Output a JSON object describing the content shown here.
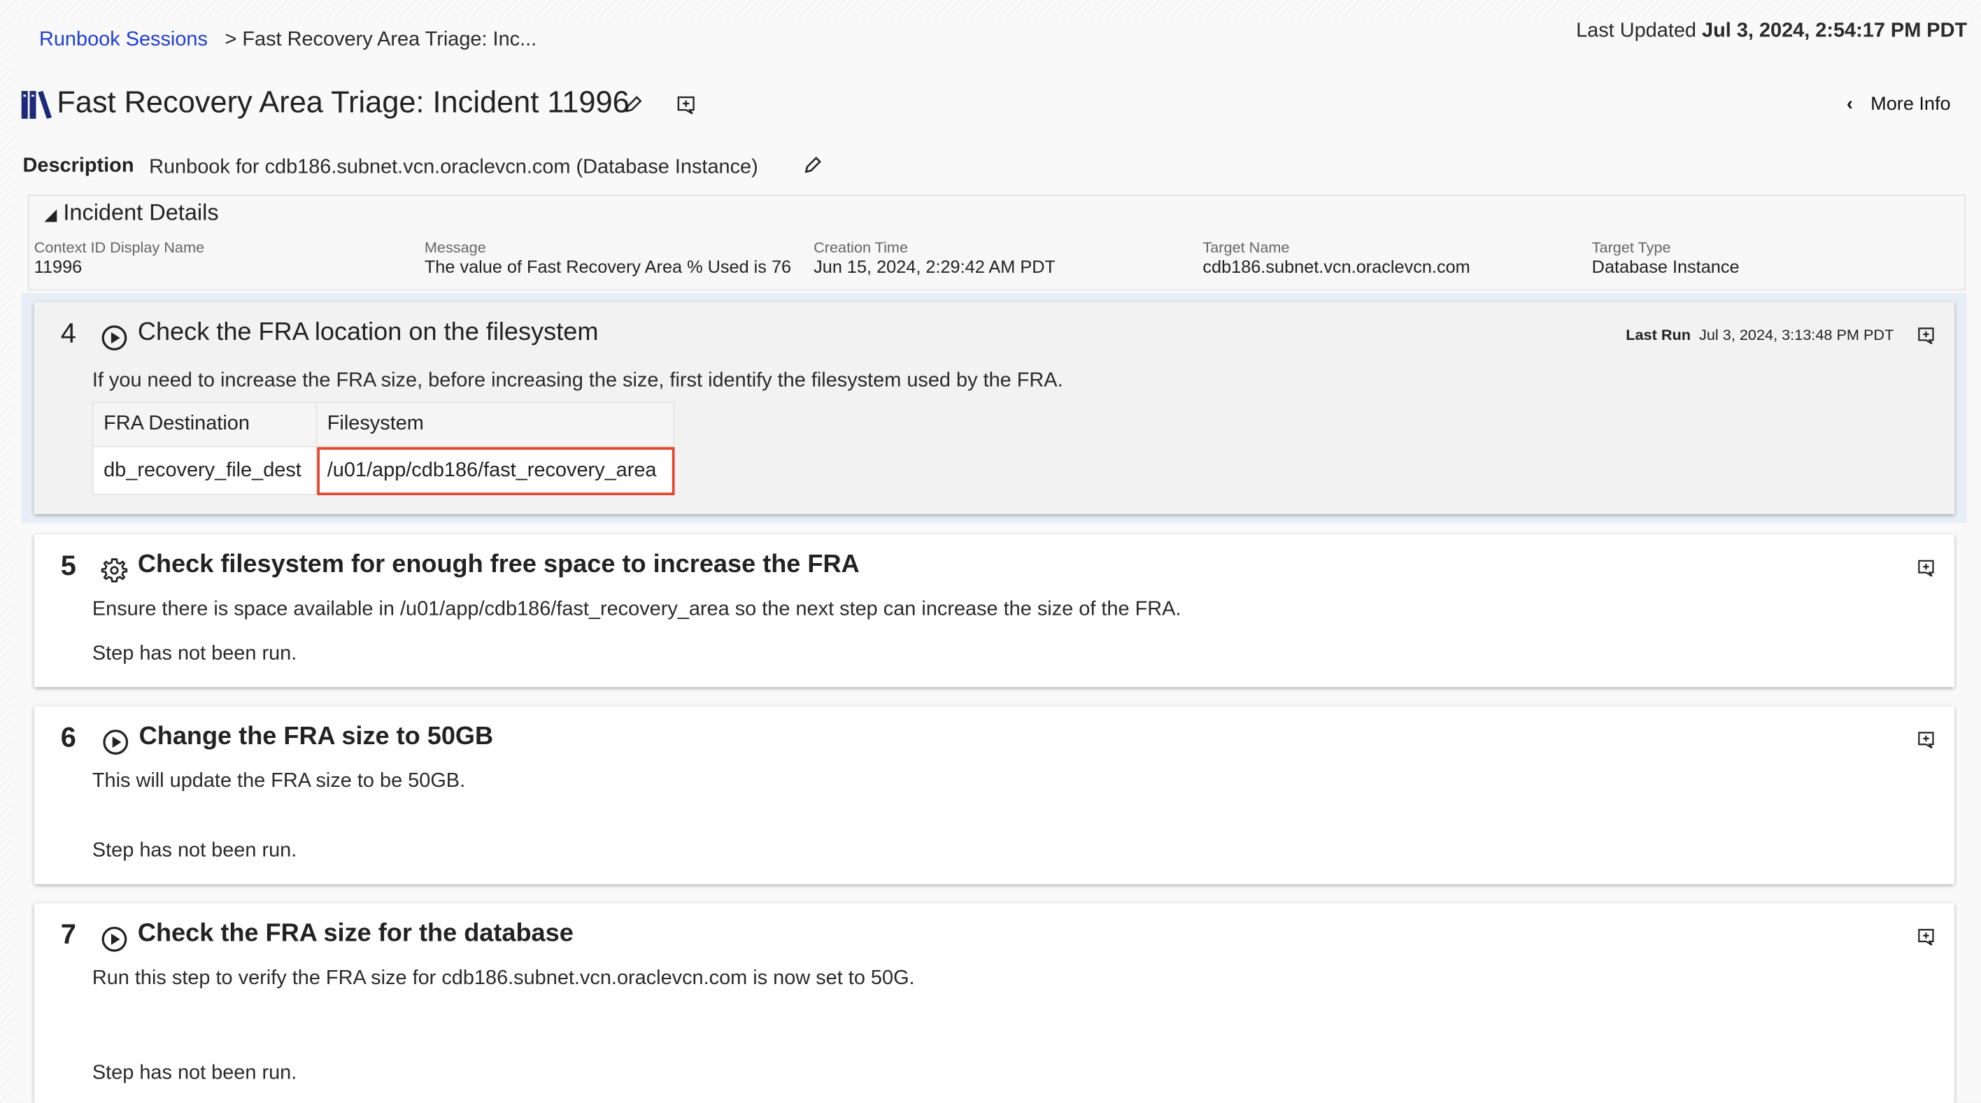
{
  "breadcrumb": {
    "link": "Runbook Sessions",
    "current": "> Fast Recovery Area Triage: Inc..."
  },
  "last_updated": {
    "label": "Last Updated",
    "value": "Jul 3, 2024, 2:54:17 PM PDT"
  },
  "header": {
    "title": "Fast Recovery Area Triage: Incident 11996",
    "more_info": "More Info"
  },
  "description": {
    "label": "Description",
    "text": "Runbook for cdb186.subnet.vcn.oraclevcn.com (Database Instance)"
  },
  "incident": {
    "heading": "Incident Details",
    "fields": [
      {
        "label": "Context ID Display Name",
        "value": "11996"
      },
      {
        "label": "Message",
        "value": "The value of Fast Recovery Area % Used is 76"
      },
      {
        "label": "Creation Time",
        "value": "Jun 15, 2024, 2:29:42 AM PDT"
      },
      {
        "label": "Target Name",
        "value": "cdb186.subnet.vcn.oraclevcn.com"
      },
      {
        "label": "Target Type",
        "value": "Database Instance"
      }
    ]
  },
  "steps": [
    {
      "number": "4",
      "icon": "play-circle-icon",
      "title": "Check the FRA location on the filesystem",
      "last_run_label": "Last Run",
      "last_run": "Jul 3, 2024, 3:13:48 PM PDT",
      "description": "If you need to increase the FRA size, before increasing the size, first identify the filesystem used by the FRA.",
      "table": {
        "headers": [
          "FRA Destination",
          "Filesystem"
        ],
        "rows": [
          [
            "db_recovery_file_dest",
            "/u01/app/cdb186/fast_recovery_area"
          ]
        ]
      }
    },
    {
      "number": "5",
      "icon": "gear-icon",
      "title": "Check filesystem for enough free space to increase the FRA",
      "description": "Ensure there is space available in /u01/app/cdb186/fast_recovery_area so the next step can increase the size of the FRA.",
      "status": "Step has not been run."
    },
    {
      "number": "6",
      "icon": "play-circle-icon",
      "title": "Change the FRA size to 50GB",
      "description": "This will update the FRA size to be 50GB.",
      "status": "Step has not been run."
    },
    {
      "number": "7",
      "icon": "play-circle-icon",
      "title": "Check the FRA size for the database",
      "description": "Run this step to verify the FRA size for cdb186.subnet.vcn.oraclevcn.com is now set to 50G.",
      "status": "Step has not been run."
    }
  ],
  "colors": {
    "link": "#1f3fd4",
    "highlight_border": "#e5432a",
    "active_step_bg": "#e8eef6",
    "book_icon": "#1d2a7a"
  }
}
